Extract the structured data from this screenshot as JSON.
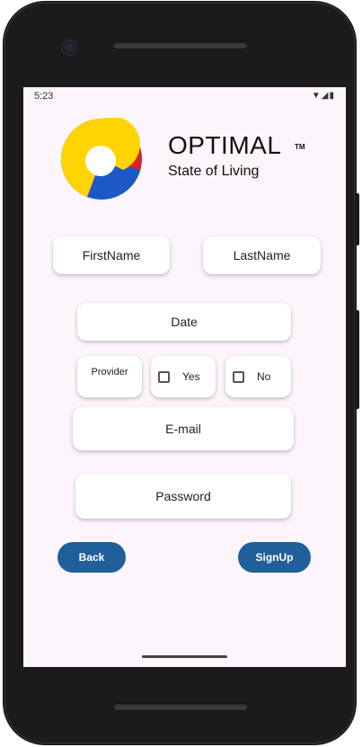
{
  "status_bar": {
    "time": "5:23",
    "icons": "▼◢▮"
  },
  "brand": {
    "name": "OPTIMAL",
    "trademark": "TM",
    "tagline": "State of Living"
  },
  "form": {
    "first_name_placeholder": "FirstName",
    "last_name_placeholder": "LastName",
    "date_placeholder": "Date",
    "provider_label": "Provider",
    "yes_label": "Yes",
    "no_label": "No",
    "email_placeholder": "E-mail",
    "password_placeholder": "Password"
  },
  "actions": {
    "back_label": "Back",
    "signup_label": "SignUp"
  },
  "colors": {
    "accent": "#1f5f9a",
    "screen_bg": "#fcf5fb",
    "logo_yellow": "#ffd400",
    "logo_red": "#e02020",
    "logo_blue": "#1c58c8"
  }
}
